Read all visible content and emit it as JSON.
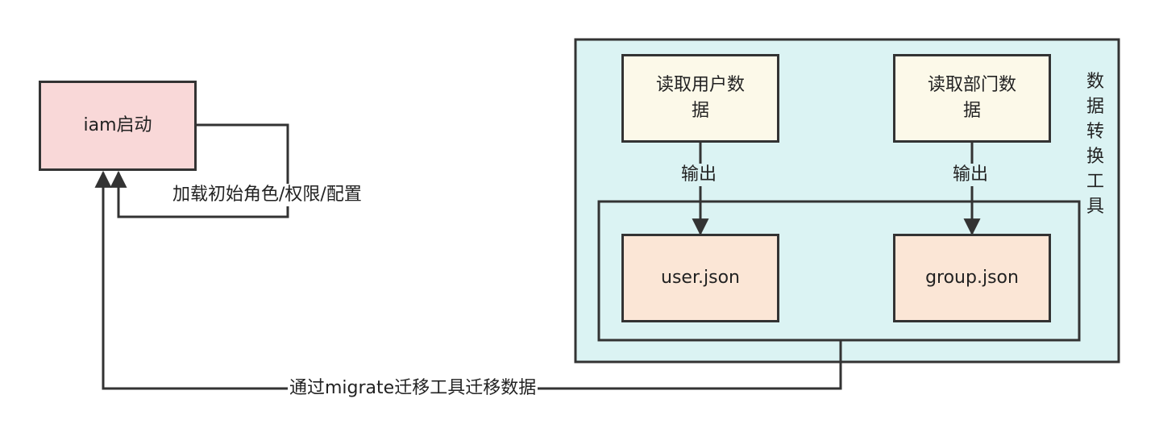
{
  "nodes": {
    "iam_start": "iam启动",
    "read_user": "读取用户数据",
    "read_dept": "读取部门数据",
    "user_json": "user.json",
    "group_json": "group.json"
  },
  "tool_label": "数据转换工具",
  "edges": {
    "self_loop": "加载初始角色/权限/配置",
    "output_user": "输出",
    "output_dept": "输出",
    "migrate": "通过migrate迁移工具迁移数据"
  },
  "colors": {
    "pink": "#f9d8d8",
    "cyan": "#dbf3f3",
    "cream": "#fcf9e9",
    "peach": "#fbe6d6",
    "stroke": "#333333"
  }
}
